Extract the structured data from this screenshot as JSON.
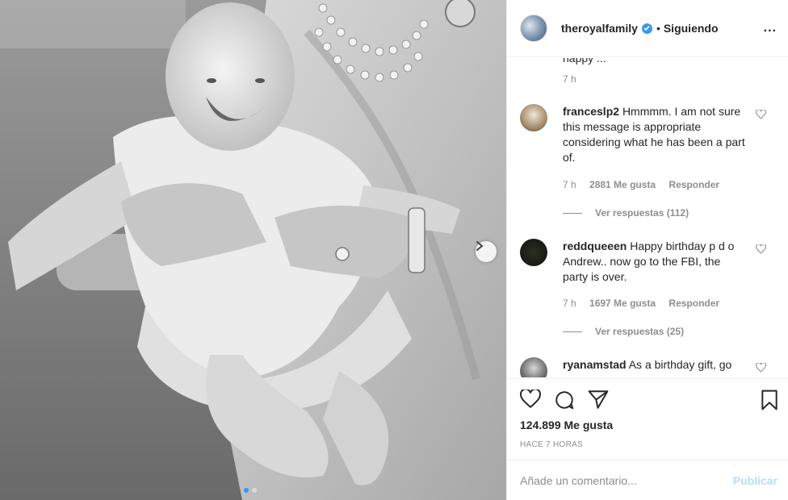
{
  "photo": {
    "description_icon": "photo-carousel",
    "next_icon": "chevron-right-icon",
    "dots": [
      true,
      false
    ]
  },
  "header": {
    "username": "theroyalfamily",
    "separator": "•",
    "following": "Siguiendo",
    "more": "..."
  },
  "comments": {
    "partial_text": "happy ...",
    "first_time": "7 h",
    "items": [
      {
        "user": "franceslp2",
        "text": "Hmmmm. I am not sure this message is appropriate considering what he has been a part of.",
        "time": "7 h",
        "likes": "2881 Me gusta",
        "reply": "Responder",
        "view_replies": "Ver respuestas (112)"
      },
      {
        "user": "reddqueeen",
        "text": "Happy birthday p d o Andrew.. now go to the FBI, the party is over.",
        "time": "7 h",
        "likes": "1697 Me gusta",
        "reply": "Responder",
        "view_replies": "Ver respuestas (25)"
      },
      {
        "user": "ryanamstad",
        "text": "As a birthday gift, go",
        "time": "",
        "likes": "",
        "reply": "",
        "view_replies": ""
      }
    ]
  },
  "actions": {
    "likes": "124.899 Me gusta",
    "ago": "HACE 7 HORAS"
  },
  "add_comment": {
    "placeholder": "Añade un comentario...",
    "publish": "Publicar"
  },
  "colors": {
    "link_blue": "#3897f0",
    "publish_disabled": "#b2dffc",
    "muted": "#8e8e8e"
  }
}
